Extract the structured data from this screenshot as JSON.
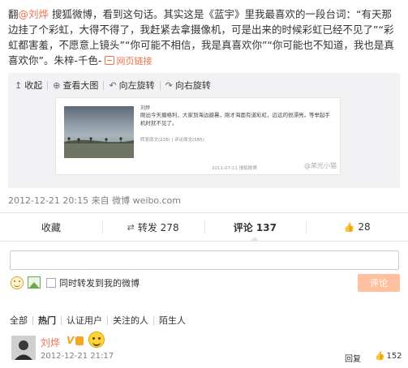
{
  "post": {
    "prefix": "翻",
    "mention": "@刘烨",
    "text": " 搜狐微博，看到这句话。其实这是《蓝宇》里我最喜欢的一段台词：“有天那边挂了个彩虹，大得不得了，我赶紧去拿摄像机，可是出来的时候彩虹已经不见了”“彩虹都害羞，不愿意上镜头”“你可能不相信，我是真喜欢你”“你可能也不知道，我也是真喜欢你”。朱梓-千色- ",
    "link_label": "网页链接"
  },
  "media": {
    "collapse_label": "收起",
    "view_large_label": "查看大图",
    "rotate_left_label": "向左旋转",
    "rotate_right_label": "向右旋转",
    "inner_author": "刘烨",
    "inner_text": "刚出今天摄格利，大家到海边避暑，刚才海面有道彩虹，远远的很漂亮，等举起手机时就不见了。",
    "inner_actions": "转发原文(228) | 评论原文(585)",
    "inner_time": "2011-07-11  搜狐微博",
    "watermark": "@荣光小猫"
  },
  "meta": {
    "timestamp": "2012-12-21 20:15",
    "source_prefix": "来自",
    "source": "微博 weibo.com"
  },
  "actions": {
    "favorite_label": "收藏",
    "repost_label": "转发 278",
    "comment_label": "评论 137",
    "like_count": "28"
  },
  "composer": {
    "input_value": "",
    "repost_checkbox_label": "同时转发到我的微博",
    "submit_label": "评论"
  },
  "filters": {
    "all": "全部",
    "hot": "热门",
    "verified": "认证用户",
    "following": "关注的人",
    "strangers": "陌生人"
  },
  "comment": {
    "author": "刘烨",
    "badge": "V",
    "time": "2012-12-21 21:17",
    "reply_label": "回复",
    "like_count": "152"
  },
  "colors": {
    "accent": "#eb7350",
    "submit_disabled": "#ffc09f",
    "badge_gold": "#f5a623"
  },
  "icons": {
    "collapse": "collapse-arrow-icon",
    "view_large": "zoom-icon",
    "rotate_left": "rotate-left-icon",
    "rotate_right": "rotate-right-icon",
    "repost": "repost-icon",
    "like": "thumbs-up-icon",
    "emoji": "smile-icon",
    "image": "image-icon"
  }
}
